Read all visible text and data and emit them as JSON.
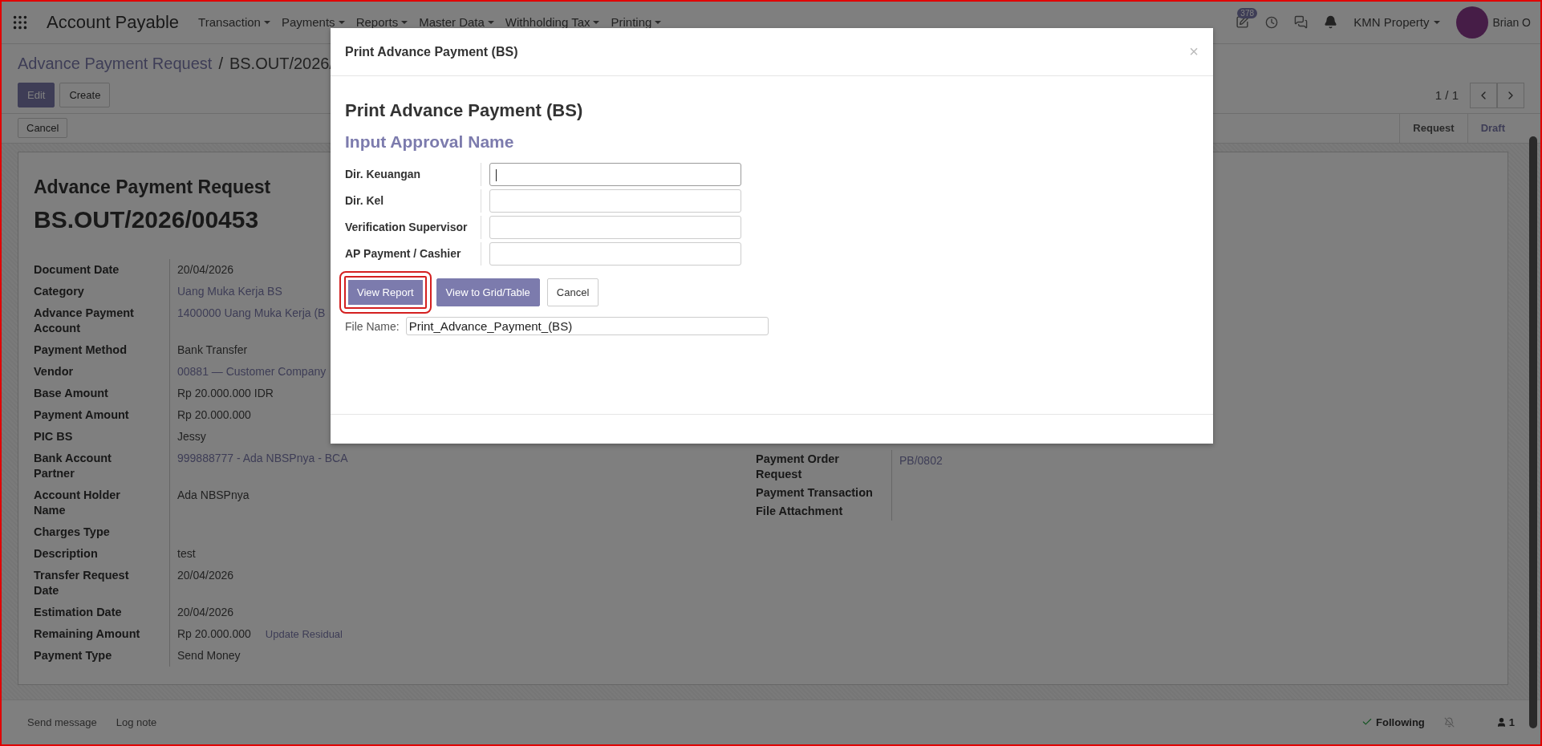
{
  "navbar": {
    "app_title": "Account Payable",
    "menus": [
      "Transaction",
      "Payments",
      "Reports",
      "Master Data",
      "Withholding Tax",
      "Printing"
    ],
    "activity_count": "378",
    "company": "KMN Property",
    "user": "Brian O"
  },
  "breadcrumb": {
    "parent": "Advance Payment Request",
    "separator": "/",
    "current": "BS.OUT/2026/"
  },
  "buttons": [
    {
      "label": "Edit",
      "kind": "primary"
    },
    {
      "label": "Create",
      "kind": "secondary"
    }
  ],
  "pager": "1 / 1",
  "action_buttons": [
    "Cancel"
  ],
  "statusbar": [
    {
      "label": "Request",
      "selected": false
    },
    {
      "label": "Draft",
      "selected": true
    }
  ],
  "record": {
    "title": "Advance Payment Request",
    "number": "BS.OUT/2026/00453",
    "fields": [
      {
        "label": "Document Date",
        "value": "20/04/2026",
        "kind": "text"
      },
      {
        "label": "Category",
        "value": "Uang Muka Kerja BS",
        "kind": "link"
      },
      {
        "label": "Advance Payment Account",
        "value": "1400000 Uang Muka Kerja (B",
        "kind": "link"
      },
      {
        "label": "Payment Method",
        "value": "Bank Transfer",
        "kind": "text"
      },
      {
        "label": "Vendor",
        "value": "00881 — Customer Company",
        "kind": "link"
      },
      {
        "label": "Base Amount",
        "value": "Rp 20.000.000  IDR",
        "kind": "text"
      },
      {
        "label": "Payment Amount",
        "value": "Rp 20.000.000",
        "kind": "text"
      },
      {
        "label": "PIC BS",
        "value": "Jessy",
        "kind": "text"
      },
      {
        "label": "Bank Account Partner",
        "value": "999888777 - Ada NBSPnya - BCA",
        "kind": "link"
      },
      {
        "label": "Account Holder Name",
        "value": "Ada NBSPnya",
        "kind": "text"
      },
      {
        "label": "Charges Type"
      },
      {
        "label": "Description",
        "value": "test",
        "kind": "text"
      },
      {
        "label": "Transfer Request Date",
        "value": "20/04/2026",
        "kind": "text"
      },
      {
        "label": "Estimation Date",
        "value": "20/04/2026",
        "kind": "text"
      },
      {
        "label": "Remaining Amount",
        "value": "Rp 20.000.000",
        "kind": "text",
        "action": "Update Residual"
      },
      {
        "label": "Payment Type",
        "value": "Send Money",
        "kind": "text"
      }
    ],
    "right_fields": [
      {
        "label": "Payment Order Request",
        "value": "PB/0802",
        "kind": "link"
      },
      {
        "label": "Payment Transaction"
      },
      {
        "label": "File Attachment"
      }
    ]
  },
  "chatter": {
    "actions": [
      "Send message",
      "Log note"
    ],
    "following": "Following",
    "followers": "1"
  },
  "dialog": {
    "title": "Print Advance Payment (BS)",
    "close": "×",
    "heading": "Print Advance Payment (BS)",
    "subheading": "Input Approval Name",
    "fields": [
      {
        "label": "Dir. Keuangan",
        "focused": true
      },
      {
        "label": "Dir. Kel",
        "focused": false
      },
      {
        "label": "Verification Supervisor",
        "focused": false
      },
      {
        "label": "AP Payment / Cashier",
        "focused": false
      }
    ],
    "buttons": [
      {
        "label": "View Report",
        "kind": "primary",
        "highlighted": true
      },
      {
        "label": "View to Grid/Table",
        "kind": "primary",
        "highlighted": false
      },
      {
        "label": "Cancel",
        "kind": "secondary",
        "highlighted": false
      }
    ],
    "file_name": {
      "label": "File Name:",
      "value": "Print_Advance_Payment_(BS)"
    }
  }
}
